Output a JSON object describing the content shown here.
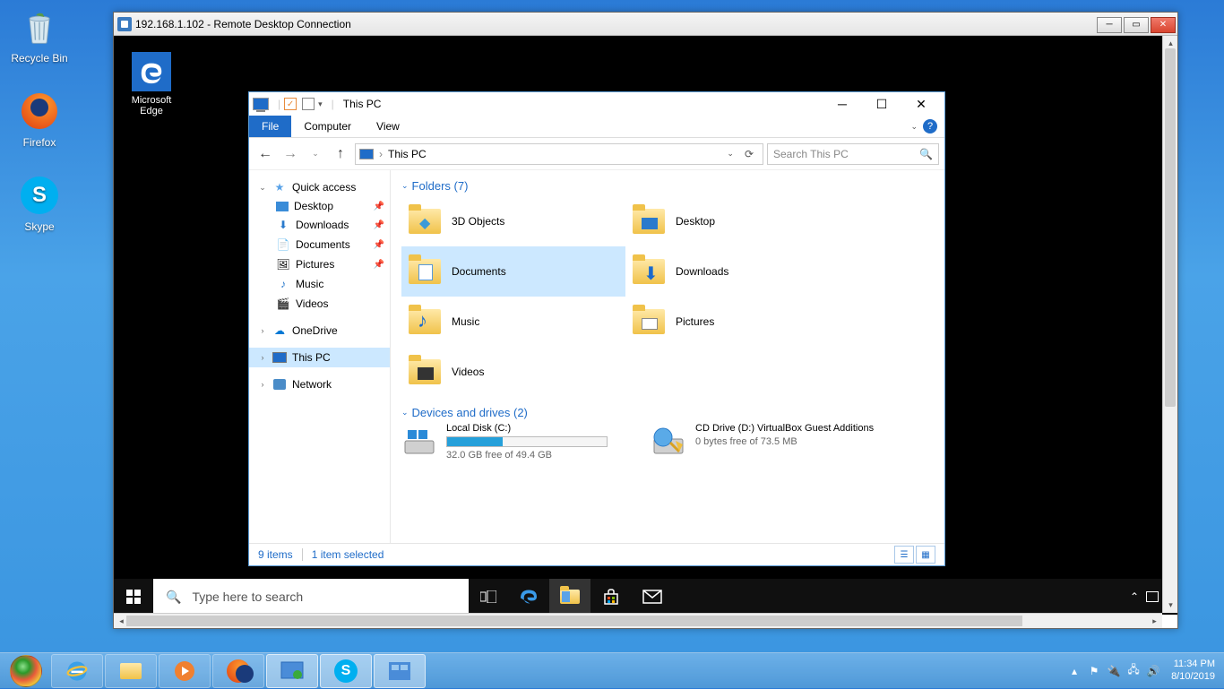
{
  "host_desktop": {
    "recycle": "Recycle Bin",
    "firefox": "Firefox",
    "skype": "Skype"
  },
  "rdp": {
    "title": "192.168.1.102 - Remote Desktop Connection"
  },
  "remote_desktop": {
    "edge": "Microsoft Edge"
  },
  "explorer": {
    "title": "This PC",
    "ribbon": {
      "file": "File",
      "computer": "Computer",
      "view": "View"
    },
    "address": "This PC",
    "search_placeholder": "Search This PC",
    "sidebar": {
      "quick": "Quick access",
      "desktop": "Desktop",
      "downloads": "Downloads",
      "documents": "Documents",
      "pictures": "Pictures",
      "music": "Music",
      "videos": "Videos",
      "onedrive": "OneDrive",
      "thispc": "This PC",
      "network": "Network"
    },
    "sections": {
      "folders_hdr": "Folders (7)",
      "drives_hdr": "Devices and drives (2)"
    },
    "folders": {
      "f0": "3D Objects",
      "f1": "Desktop",
      "f2": "Documents",
      "f3": "Downloads",
      "f4": "Music",
      "f5": "Pictures",
      "f6": "Videos"
    },
    "drives": {
      "c_label": "Local Disk (C:)",
      "c_free": "32.0 GB free of 49.4 GB",
      "d_label": "CD Drive (D:) VirtualBox Guest Additions",
      "d_free": "0 bytes free of 73.5 MB"
    },
    "status": {
      "items": "9 items",
      "selected": "1 item selected"
    }
  },
  "remote_taskbar": {
    "search": "Type here to search"
  },
  "host_taskbar": {
    "time": "11:34 PM",
    "date": "8/10/2019"
  }
}
